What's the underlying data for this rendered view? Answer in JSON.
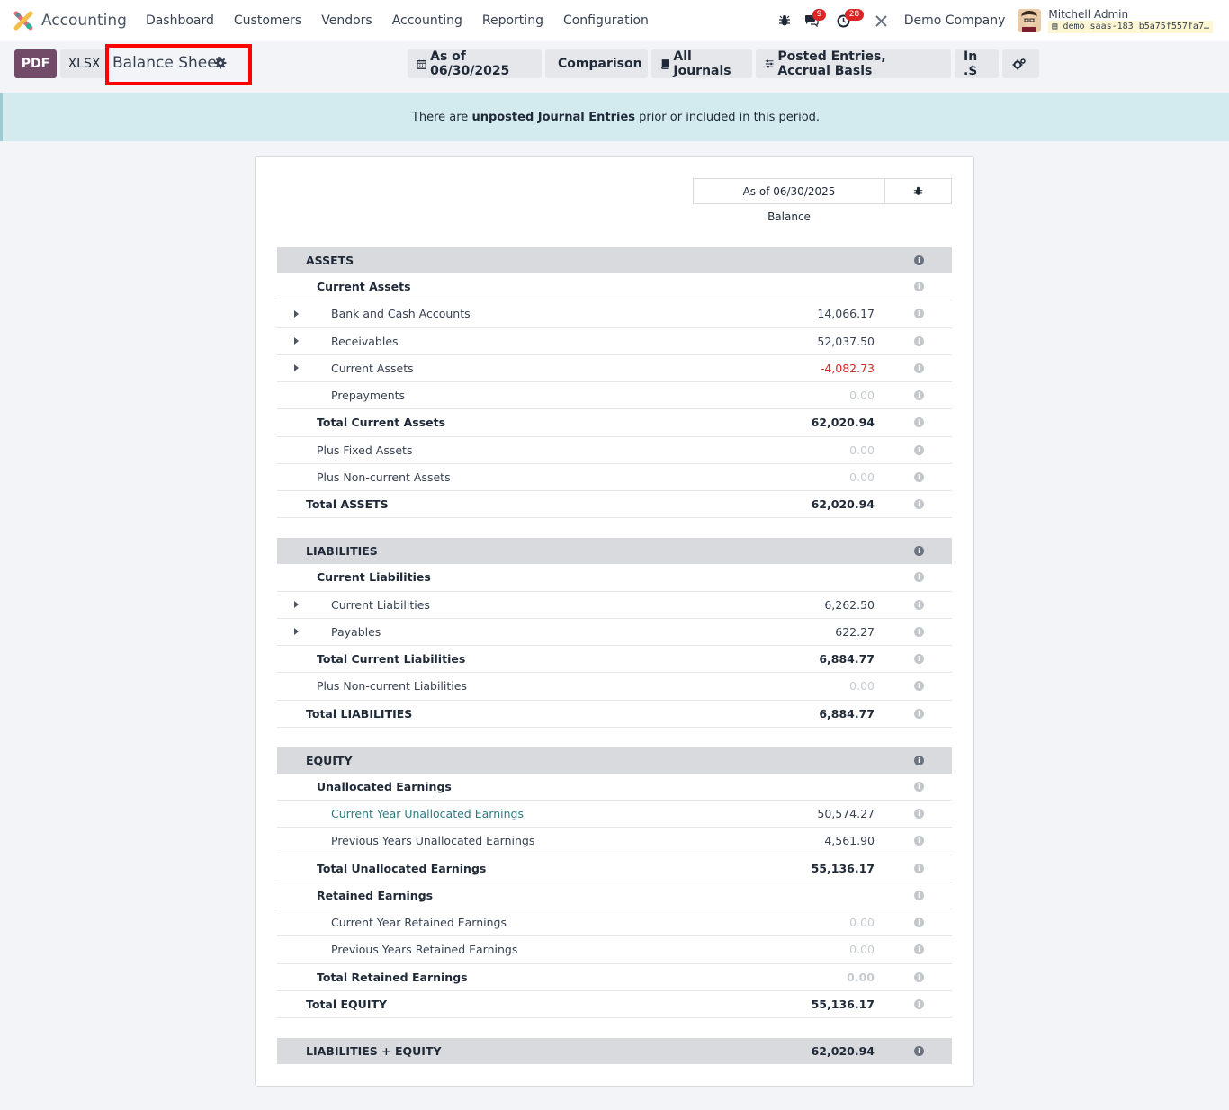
{
  "app": {
    "title": "Accounting",
    "menu": [
      "Dashboard",
      "Customers",
      "Vendors",
      "Accounting",
      "Reporting",
      "Configuration"
    ],
    "badges": {
      "messages": "9",
      "activities": "28"
    },
    "company": "Demo Company",
    "user": {
      "name": "Mitchell Admin",
      "db": "demo_saas-183_b5a75f557fa7…"
    }
  },
  "toolbar": {
    "pdf_label": "PDF",
    "xlsx_label": "XLSX",
    "report_title": "Balance Sheet",
    "filters": {
      "date": "As of 06/30/2025",
      "comparison": "Comparison",
      "journals": "All Journals",
      "entries": "Posted Entries, Accrual Basis",
      "currency": "In .$"
    }
  },
  "alert": {
    "prefix": "There are ",
    "bold": "unposted Journal Entries",
    "suffix": " prior or included in this period."
  },
  "report": {
    "column_header": "As of 06/30/2025",
    "column_sub": "Balance",
    "rows": [
      {
        "label": "ASSETS",
        "value": "",
        "type": "section"
      },
      {
        "label": "Current Assets",
        "value": "",
        "type": "lvl1 bold"
      },
      {
        "label": "Bank and Cash Accounts",
        "value": "14,066.17",
        "type": "lvl2",
        "caret": true
      },
      {
        "label": "Receivables",
        "value": "52,037.50",
        "type": "lvl2",
        "caret": true
      },
      {
        "label": "Current Assets",
        "value": "-4,082.73",
        "type": "lvl2",
        "caret": true,
        "neg": true
      },
      {
        "label": "Prepayments",
        "value": "0.00",
        "type": "lvl2",
        "muted": true
      },
      {
        "label": "Total Current Assets",
        "value": "62,020.94",
        "type": "lvl1 bold"
      },
      {
        "label": "Plus Fixed Assets",
        "value": "0.00",
        "type": "lvl1",
        "muted": true
      },
      {
        "label": "Plus Non-current Assets",
        "value": "0.00",
        "type": "lvl1",
        "muted": true
      },
      {
        "label": "Total ASSETS",
        "value": "62,020.94",
        "type": "lvl0"
      },
      {
        "type": "gap"
      },
      {
        "label": "LIABILITIES",
        "value": "",
        "type": "section"
      },
      {
        "label": "Current Liabilities",
        "value": "",
        "type": "lvl1 bold"
      },
      {
        "label": "Current Liabilities",
        "value": "6,262.50",
        "type": "lvl2",
        "caret": true
      },
      {
        "label": "Payables",
        "value": "622.27",
        "type": "lvl2",
        "caret": true
      },
      {
        "label": "Total Current Liabilities",
        "value": "6,884.77",
        "type": "lvl1 bold"
      },
      {
        "label": "Plus Non-current Liabilities",
        "value": "0.00",
        "type": "lvl1",
        "muted": true
      },
      {
        "label": "Total LIABILITIES",
        "value": "6,884.77",
        "type": "lvl0"
      },
      {
        "type": "gap"
      },
      {
        "label": "EQUITY",
        "value": "",
        "type": "section"
      },
      {
        "label": "Unallocated Earnings",
        "value": "",
        "type": "lvl1 bold"
      },
      {
        "label": "Current Year Unallocated Earnings",
        "value": "50,574.27",
        "type": "lvl2",
        "link": true
      },
      {
        "label": "Previous Years Unallocated Earnings",
        "value": "4,561.90",
        "type": "lvl2"
      },
      {
        "label": "Total Unallocated Earnings",
        "value": "55,136.17",
        "type": "lvl1 bold"
      },
      {
        "label": "Retained Earnings",
        "value": "",
        "type": "lvl1 bold"
      },
      {
        "label": "Current Year Retained Earnings",
        "value": "0.00",
        "type": "lvl2",
        "muted": true
      },
      {
        "label": "Previous Years Retained Earnings",
        "value": "0.00",
        "type": "lvl2",
        "muted": true
      },
      {
        "label": "Total Retained Earnings",
        "value": "0.00",
        "type": "lvl1 bold",
        "muted": true
      },
      {
        "label": "Total EQUITY",
        "value": "55,136.17",
        "type": "lvl0"
      },
      {
        "type": "gap"
      },
      {
        "label": "LIABILITIES + EQUITY",
        "value": "62,020.94",
        "type": "section"
      }
    ]
  },
  "colors": {
    "brand": "#714b67",
    "highlight": "#ff0000",
    "alert_bg": "#d3ebef",
    "negative": "#dc2626",
    "link": "#2d7a80"
  }
}
